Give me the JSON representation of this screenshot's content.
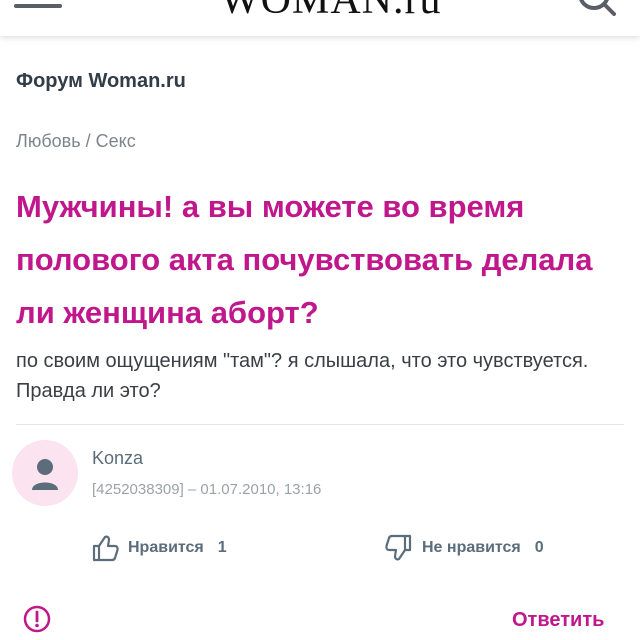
{
  "header": {
    "logo_text": "WOMAN.ru",
    "menu_icon": "hamburger-icon",
    "search_icon": "search-icon"
  },
  "forum": {
    "title": "Форум Woman.ru"
  },
  "breadcrumb": {
    "category": "Любовь",
    "separator": "/",
    "subcategory": "Секс"
  },
  "topic": {
    "title": "Мужчины! а вы можете во время полового акта почувствовать делала ли женщина аборт?",
    "body": "по своим ощущениям \"там\"? я слышала, что это чувствуется. Правда ли это?"
  },
  "post": {
    "author": "Konza",
    "meta": "[4252038309] – 01.07.2010, 13:16",
    "likes_label": "Нравится",
    "likes_count": "1",
    "dislikes_label": "Не нравится",
    "dislikes_count": "0"
  },
  "actions": {
    "reply_label": "Ответить",
    "report_icon": "alert-circle-icon"
  },
  "colors": {
    "accent": "#c0178c",
    "avatar_bg": "#fbe3ef",
    "muted": "#5b6c7a"
  }
}
